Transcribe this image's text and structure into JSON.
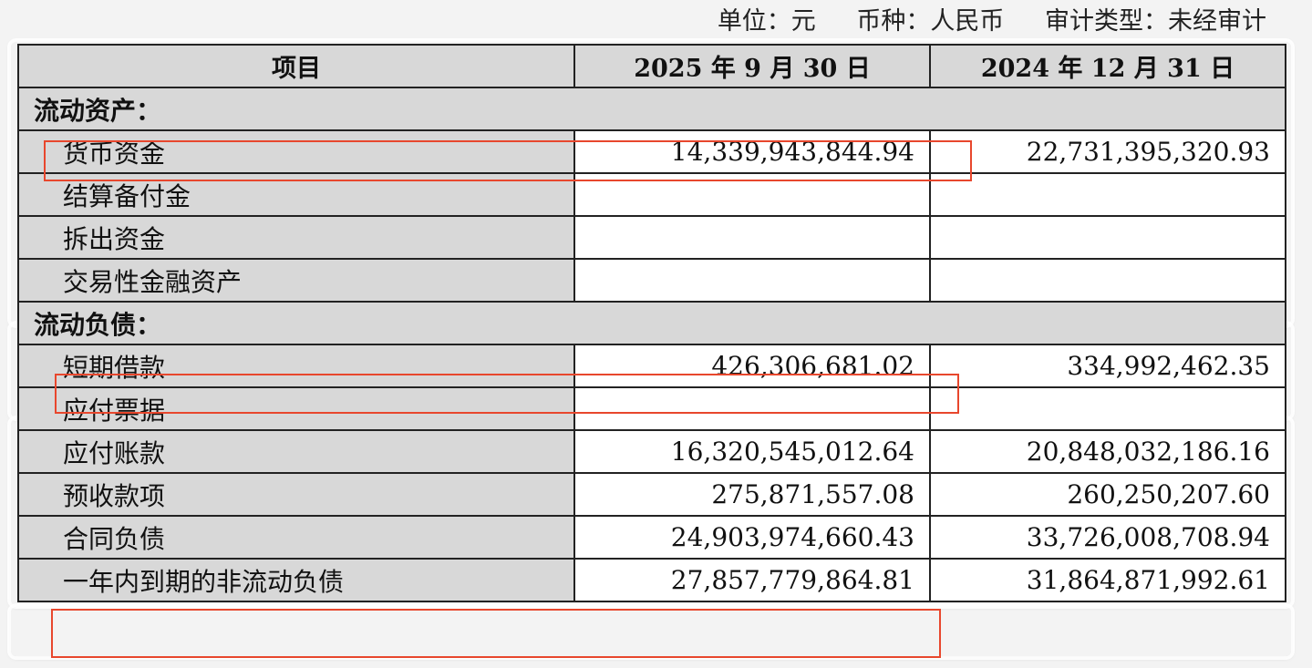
{
  "header": {
    "unit": "单位：元",
    "currency": "币种：人民币",
    "audit": "审计类型：未经审计"
  },
  "table": {
    "columns": [
      "项目",
      "2025 年 9 月 30 日",
      "2024 年 12 月 31 日"
    ],
    "rows": [
      {
        "kind": "section",
        "label": "流动资产：",
        "v2025": "",
        "v2024": ""
      },
      {
        "kind": "item",
        "label": "货币资金",
        "v2025": "14,339,943,844.94",
        "v2024": "22,731,395,320.93"
      },
      {
        "kind": "item",
        "label": "结算备付金",
        "v2025": "",
        "v2024": ""
      },
      {
        "kind": "item",
        "label": "拆出资金",
        "v2025": "",
        "v2024": ""
      },
      {
        "kind": "item",
        "label": "交易性金融资产",
        "v2025": "",
        "v2024": ""
      },
      {
        "kind": "section",
        "label": "流动负债：",
        "v2025": "",
        "v2024": ""
      },
      {
        "kind": "item",
        "label": "短期借款",
        "v2025": "426,306,681.02",
        "v2024": "334,992,462.35"
      },
      {
        "kind": "item",
        "label": "应付票据",
        "v2025": "",
        "v2024": ""
      },
      {
        "kind": "item",
        "label": "应付账款",
        "v2025": "16,320,545,012.64",
        "v2024": "20,848,032,186.16"
      },
      {
        "kind": "item",
        "label": "预收款项",
        "v2025": "275,871,557.08",
        "v2024": "260,250,207.60"
      },
      {
        "kind": "item",
        "label": "合同负债",
        "v2025": "24,903,974,660.43",
        "v2024": "33,726,008,708.94"
      },
      {
        "kind": "item",
        "label": "一年内到期的非流动负债",
        "v2025": "27,857,779,864.81",
        "v2024": "31,864,871,992.61"
      }
    ]
  },
  "highlight_color": "#e8472d"
}
